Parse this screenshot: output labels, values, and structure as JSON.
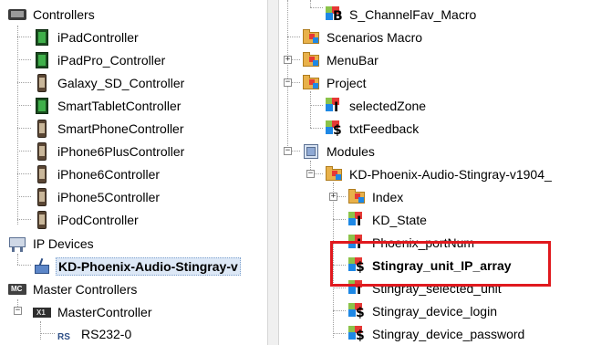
{
  "left_tree": {
    "controllers": {
      "label": "Controllers",
      "items": [
        "iPadController",
        "iPadPro_Controller",
        "Galaxy_SD_Controller",
        "SmartTabletController",
        "SmartPhoneController",
        "iPhone6PlusController",
        "iPhone6Controller",
        "iPhone5Controller",
        "iPodController"
      ]
    },
    "ip_devices": {
      "label": "IP Devices",
      "selected_item": "KD-Phoenix-Audio-Stingray-v"
    },
    "master_controllers": {
      "label": "Master Controllers",
      "master_controller": "MasterController",
      "rs232": "RS232-0",
      "mc_badge": "MC",
      "x1_badge": "X1",
      "rs_badge": "RS"
    },
    "expand_minus": "−"
  },
  "right_tree": {
    "channel_fav_macro": "S_ChannelFav_Macro",
    "scenarios_macro": "Scenarios Macro",
    "menubar": "MenuBar",
    "project": "Project",
    "selected_zone": "selectedZone",
    "txt_feedback": "txtFeedback",
    "modules": "Modules",
    "module_name": "KD-Phoenix-Audio-Stingray-v1904_",
    "index": "Index",
    "kd_state": "KD_State",
    "phoenix_portnum": "Phoenix_portNum",
    "stingray_ip_array": "Stingray_unit_IP_array",
    "stingray_selected_unit": "Stingray_selected_unit",
    "stingray_device_login": "Stingray_device_login",
    "stingray_device_password": "Stingray_device_password",
    "badge_b": "B",
    "badge_i": "I",
    "badge_s": "$",
    "expand_plus": "+",
    "expand_minus": "−"
  },
  "colors": {
    "highlight_border": "#e0191e",
    "selection_bg": "#dde8f6",
    "folder": "#e8b14a"
  }
}
